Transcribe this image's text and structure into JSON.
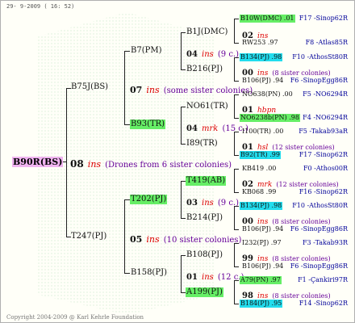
{
  "header": {
    "date": "29-  9-2009 ( 16: 52)"
  },
  "footer": {
    "copyright": "Copyright 2004-2009 @ Karl Kehrle Foundation"
  },
  "root": {
    "id": "B90R(BS)",
    "gen": "08",
    "ins": "ins",
    "note": "(Drones from 6 sister colonies)"
  },
  "f1": {
    "a": {
      "id": "B75J(BS)",
      "gen": "07",
      "ins": "ins",
      "note": "(some sister colonies)"
    },
    "b": {
      "id": "T247(PJ)",
      "gen": "05",
      "ins": "ins",
      "note": "(10 sister colonies)"
    }
  },
  "f2": {
    "a": {
      "id": "B7(PM)",
      "gen": "04",
      "ins": "ins",
      "note": "(9 c.)"
    },
    "b": {
      "id": "B93(TR)",
      "gen": "04",
      "ins": "mrk",
      "note": "(15 c.)"
    },
    "c": {
      "id": "T202(PJ)",
      "gen": "03",
      "ins": "ins",
      "note": "(9 c.)"
    },
    "d": {
      "id": "B158(PJ)",
      "gen": "01",
      "ins": "ins",
      "note": "(12 c.)"
    }
  },
  "f3": {
    "a": {
      "id": "B1J(DMC)",
      "gen": "02",
      "ins": "ins"
    },
    "b": {
      "id": "B216(PJ)",
      "gen": "00",
      "ins": "ins",
      "note": "(8 sister colonies)"
    },
    "c": {
      "id": "NO61(TR)",
      "gen": "01",
      "ins": "hbpn"
    },
    "d": {
      "id": "I89(TR)",
      "gen": "01",
      "ins": "hsl",
      "note": "(12 sister colonies)"
    },
    "e": {
      "id": "T419(AB)",
      "gen": "02",
      "ins": "mrk",
      "note": "(12 sister colonies)"
    },
    "f": {
      "id": "B214(PJ)",
      "gen": "00",
      "ins": "ins",
      "note": "(8 sister colonies)"
    },
    "g": {
      "id": "B108(PJ)",
      "gen": "99",
      "ins": "ins",
      "note": "(8 sister colonies)"
    },
    "h": {
      "id": "A199(PJ)",
      "gen": "98",
      "ins": "ins",
      "note": "(8 sister colonies)"
    }
  },
  "f4": [
    {
      "left": "B10W(DMC) .01",
      "right": "F17 -Sinop62R"
    },
    {
      "left": "RW253 .97",
      "right": "F8 -Atlas85R"
    },
    {
      "left": "B134(PJ) .98",
      "right": "F10 -AthosSt80R"
    },
    {
      "left": "B106(PJ) .94",
      "right": "F6 -SinopEgg86R"
    },
    {
      "left": "NO638(PN) .00",
      "right": "F5 -NO6294R"
    },
    {
      "left": "NO6238b(PN) .98",
      "right": "F4 -NO6294R"
    },
    {
      "left": "I100(TR) .00",
      "right": "F5 -Takab93aR"
    },
    {
      "left": "B92(TR) .99",
      "right": "F17 -Sinop62R"
    },
    {
      "left": "KB419 .00",
      "right": "F0 -Athos00R"
    },
    {
      "left": "KB068 .99",
      "right": "F16 -Sinop62R"
    },
    {
      "left": "B134(PJ) .98",
      "right": "F10 -AthosSt80R"
    },
    {
      "left": "B106(PJ) .94",
      "right": "F6 -SinopEgg86R"
    },
    {
      "left": "I232(PJ) .97",
      "right": "F3 -Takab93R"
    },
    {
      "left": "B106(PJ) .94",
      "right": "F6 -SinopEgg86R"
    },
    {
      "left": "A79(PN) .97",
      "right": "F1 -Çankiri97R"
    },
    {
      "left": "B184(PJ) .95",
      "right": "F14 -Sinop62R"
    }
  ]
}
